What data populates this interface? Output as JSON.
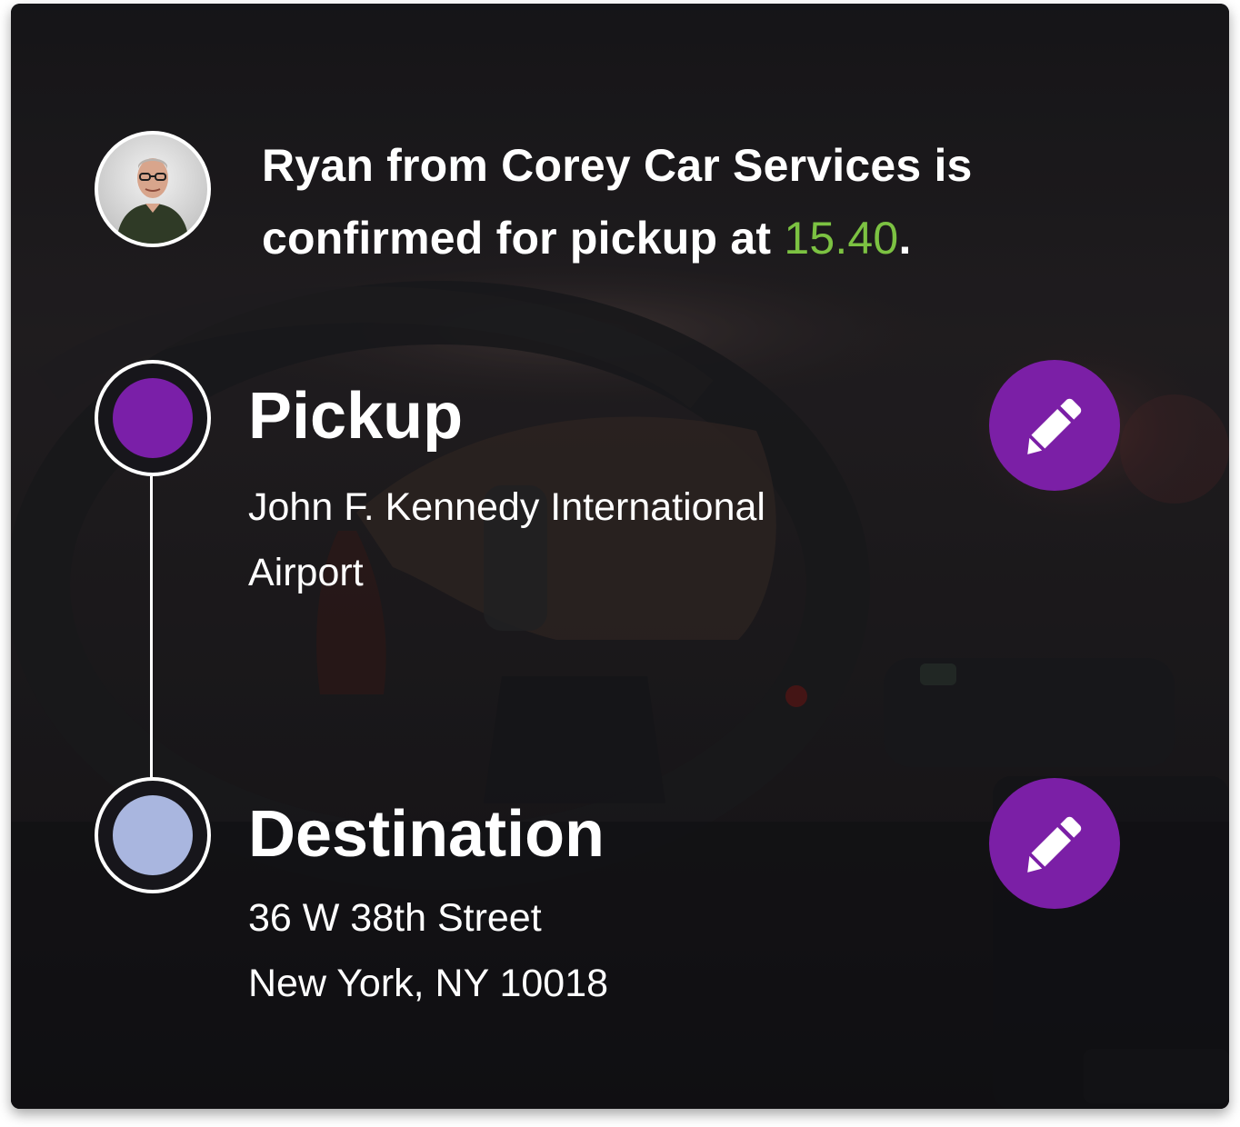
{
  "header": {
    "driver_name": "Ryan",
    "text_before_time": "Ryan from Corey Car Services is confirmed for pickup at ",
    "pickup_time": "15.40",
    "text_after_time": "."
  },
  "route": {
    "pickup": {
      "label": "Pickup",
      "address_line1": "John F. Kennedy International",
      "address_line2": "Airport",
      "dot_color": "#7a1fa8"
    },
    "destination": {
      "label": "Destination",
      "address_line1": "36 W 38th Street",
      "address_line2": "New York, NY 10018",
      "dot_color": "#a9b6df"
    }
  },
  "actions": {
    "edit_icon": "pencil-icon",
    "button_color": "#7b1fa6"
  },
  "theme": {
    "time_color": "#7cc242",
    "text_color": "#ffffff"
  }
}
